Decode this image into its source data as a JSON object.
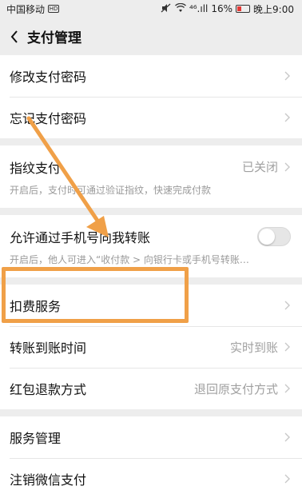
{
  "statusbar": {
    "carrier": "中国移动",
    "carrier_badge": "HD",
    "signal": "⁴⁶.ıll",
    "battery_pct": "16%",
    "time": "晚上9:00"
  },
  "navbar": {
    "back_icon": "chevron-left-icon",
    "title": "支付管理"
  },
  "groups": {
    "g1": [
      {
        "label": "修改支付密码"
      },
      {
        "label": "忘记支付密码"
      }
    ],
    "fingerprint": {
      "label": "指纹支付",
      "value": "已关闭",
      "desc": "开启后，支付时可通过验证指纹，快速完成付款"
    },
    "phone_transfer": {
      "label": "允许通过手机号向我转账",
      "desc": "开启后，他人可进入“收付款 > 向银行卡或手机号转账…",
      "enabled": false
    },
    "g4": [
      {
        "label": "扣费服务",
        "value": ""
      },
      {
        "label": "转账到账时间",
        "value": "实时到账"
      },
      {
        "label": "红包退款方式",
        "value": "退回原支付方式"
      }
    ],
    "g5": [
      {
        "label": "服务管理"
      },
      {
        "label": "注销微信支付"
      }
    ]
  },
  "colors": {
    "annotation": "#f0a048",
    "background": "#ededed",
    "secondary_text": "#a0a0a0"
  }
}
